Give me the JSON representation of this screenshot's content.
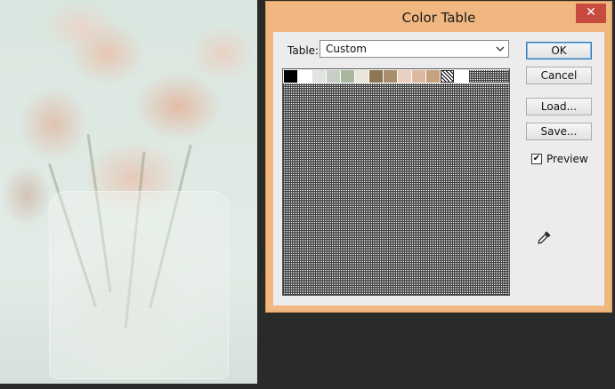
{
  "dialog": {
    "title": "Color Table",
    "close_label": "✕",
    "table_label": "Table:",
    "table_value": "Custom",
    "buttons": {
      "ok": "OK",
      "cancel": "Cancel",
      "load": "Load...",
      "save": "Save..."
    },
    "preview": {
      "label": "Preview",
      "checked": true,
      "check_glyph": "✔"
    },
    "swatches": [
      "#000000",
      "#ffffff",
      "#dfe4df",
      "#c6cfc3",
      "#aab79f",
      "#e9e5dd",
      "#8d7650",
      "#a98c69",
      "#e9cfbf",
      "#deb79f",
      "#c6a17e",
      "transparent"
    ],
    "icons": {
      "eyedropper": "eyedropper-icon",
      "close": "close-icon",
      "dropdown": "chevron-down-icon"
    }
  },
  "colors": {
    "titlebar": "#f0b780",
    "close_button": "#c74b3f",
    "client_bg": "#ececec",
    "workspace": "#2a2a2a"
  }
}
